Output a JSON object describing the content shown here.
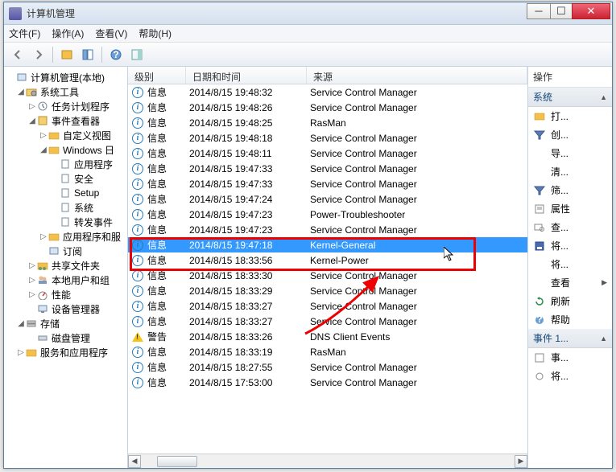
{
  "window": {
    "title": "计算机管理"
  },
  "menu": {
    "file": "文件(F)",
    "action": "操作(A)",
    "view": "查看(V)",
    "help": "帮助(H)"
  },
  "tree": {
    "root": "计算机管理(本地)",
    "systools": "系统工具",
    "scheduler": "任务计划程序",
    "eventviewer": "事件查看器",
    "customview": "自定义视图",
    "windowslog": "Windows 日",
    "appprog": "应用程序",
    "security": "安全",
    "setup": "Setup",
    "system": "系统",
    "forwarded": "转发事件",
    "appserv": "应用程序和服",
    "subscribe": "订阅",
    "shared": "共享文件夹",
    "localusers": "本地用户和组",
    "perf": "性能",
    "devmgr": "设备管理器",
    "storage": "存储",
    "diskmgr": "磁盘管理",
    "services": "服务和应用程序"
  },
  "columns": {
    "level": "级别",
    "datetime": "日期和时间",
    "source": "来源"
  },
  "levels": {
    "info": "信息",
    "warn": "警告"
  },
  "events": [
    {
      "lvl": "info",
      "dt": "2014/8/15 19:48:32",
      "src": "Service Control Manager"
    },
    {
      "lvl": "info",
      "dt": "2014/8/15 19:48:26",
      "src": "Service Control Manager"
    },
    {
      "lvl": "info",
      "dt": "2014/8/15 19:48:25",
      "src": "RasMan"
    },
    {
      "lvl": "info",
      "dt": "2014/8/15 19:48:18",
      "src": "Service Control Manager"
    },
    {
      "lvl": "info",
      "dt": "2014/8/15 19:48:11",
      "src": "Service Control Manager"
    },
    {
      "lvl": "info",
      "dt": "2014/8/15 19:47:33",
      "src": "Service Control Manager"
    },
    {
      "lvl": "info",
      "dt": "2014/8/15 19:47:33",
      "src": "Service Control Manager"
    },
    {
      "lvl": "info",
      "dt": "2014/8/15 19:47:24",
      "src": "Service Control Manager"
    },
    {
      "lvl": "info",
      "dt": "2014/8/15 19:47:23",
      "src": "Power-Troubleshooter"
    },
    {
      "lvl": "info",
      "dt": "2014/8/15 19:47:23",
      "src": "Service Control Manager"
    },
    {
      "lvl": "info",
      "dt": "2014/8/15 19:47:18",
      "src": "Kernel-General",
      "selected": true
    },
    {
      "lvl": "info",
      "dt": "2014/8/15 18:33:56",
      "src": "Kernel-Power"
    },
    {
      "lvl": "info",
      "dt": "2014/8/15 18:33:30",
      "src": "Service Control Manager"
    },
    {
      "lvl": "info",
      "dt": "2014/8/15 18:33:29",
      "src": "Service Control Manager"
    },
    {
      "lvl": "info",
      "dt": "2014/8/15 18:33:27",
      "src": "Service Control Manager"
    },
    {
      "lvl": "info",
      "dt": "2014/8/15 18:33:27",
      "src": "Service Control Manager"
    },
    {
      "lvl": "warn",
      "dt": "2014/8/15 18:33:26",
      "src": "DNS Client Events"
    },
    {
      "lvl": "info",
      "dt": "2014/8/15 18:33:19",
      "src": "RasMan"
    },
    {
      "lvl": "info",
      "dt": "2014/8/15 18:27:55",
      "src": "Service Control Manager"
    },
    {
      "lvl": "info",
      "dt": "2014/8/15 17:53:00",
      "src": "Service Control Manager"
    }
  ],
  "actions": {
    "title": "操作",
    "sec_system": "系统",
    "open": "打...",
    "create": "创...",
    "import": "导...",
    "clear": "清...",
    "filter": "筛...",
    "props": "属性",
    "find": "查...",
    "saveas": "将...",
    "attach": "将...",
    "view": "查看",
    "refresh": "刷新",
    "help": "帮助",
    "sec_event": "事件 1...",
    "evtprops": "事...",
    "evtattach": "将..."
  }
}
